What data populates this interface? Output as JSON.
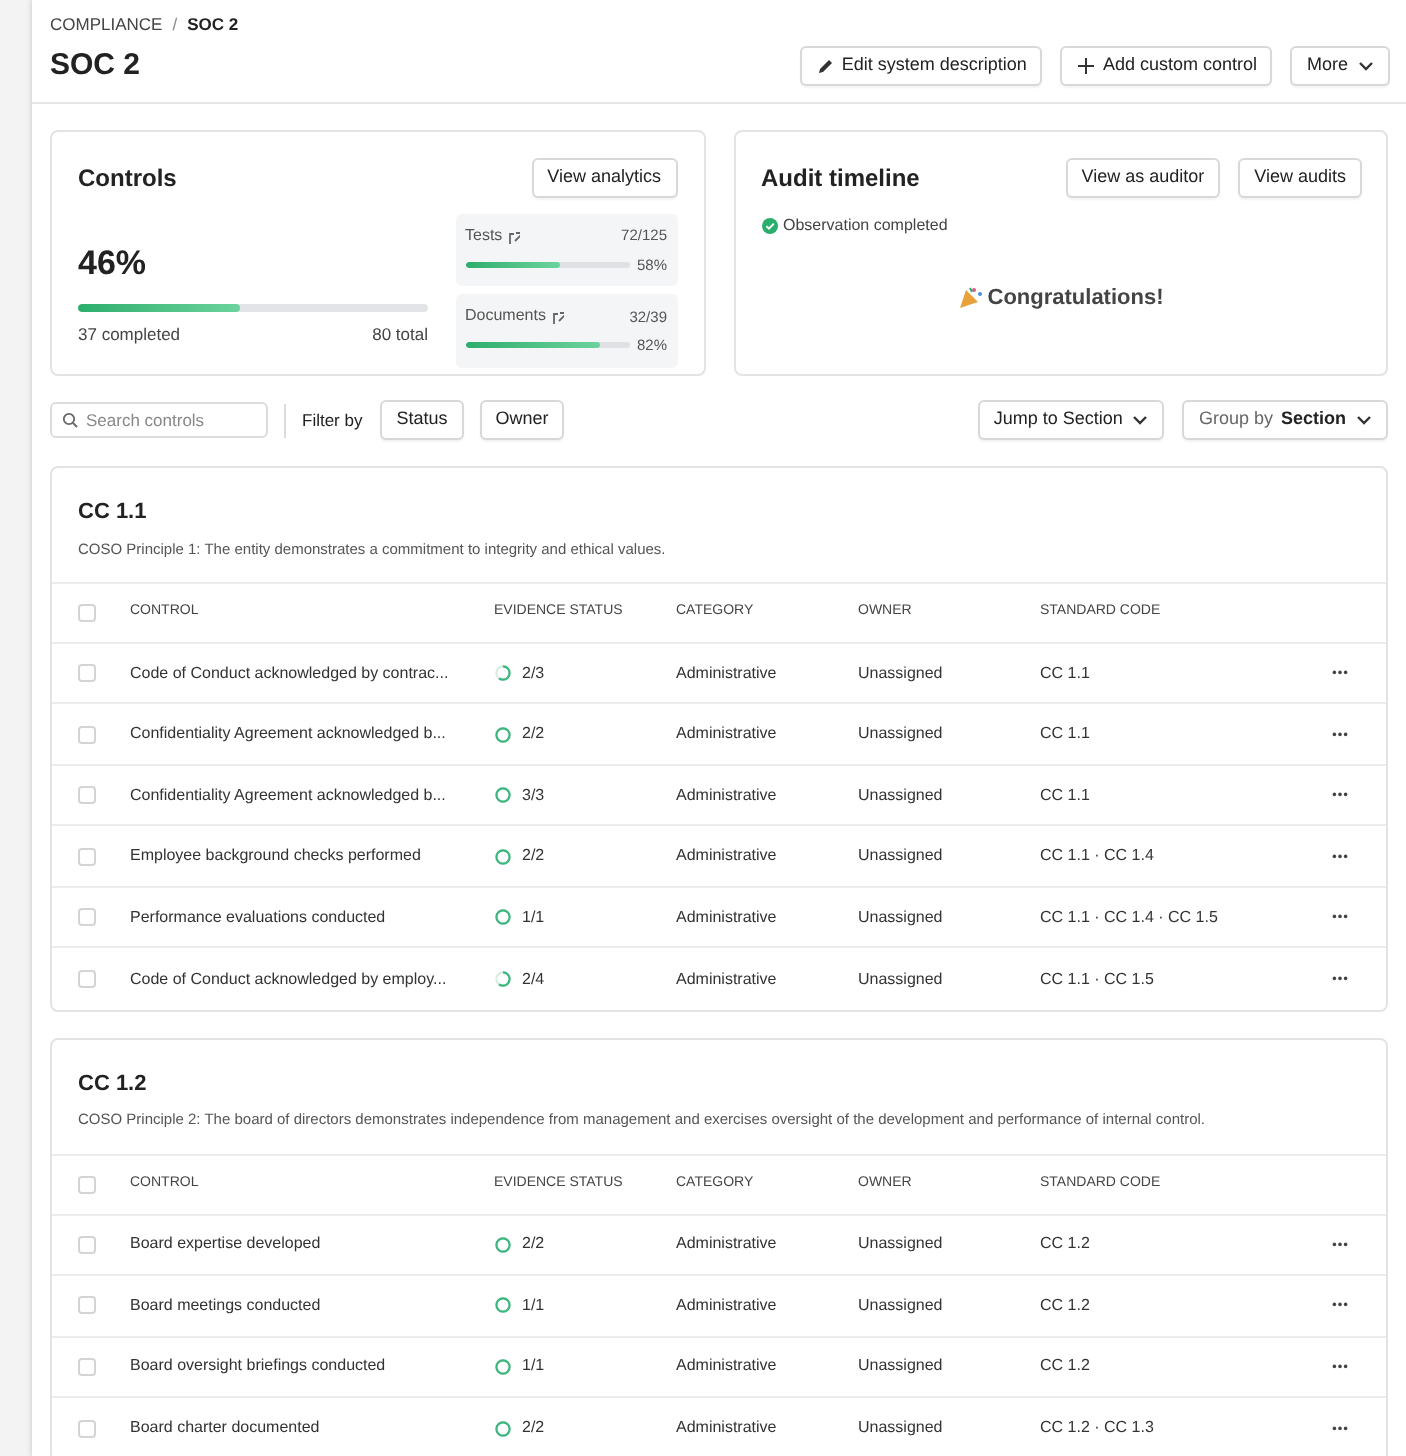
{
  "breadcrumb": [
    "COMPLIANCE",
    "/",
    "SOC 2"
  ],
  "title": "SOC 2",
  "header_buttons": [
    {
      "kind": "edit",
      "label": "Edit system description"
    },
    {
      "kind": "add",
      "label": "Add custom control"
    },
    {
      "kind": "dropdown",
      "label": "More"
    }
  ],
  "controls_card": {
    "title": "Controls",
    "button": "View analytics",
    "percent": "46%",
    "level": 0.46,
    "completed": "37 completed",
    "total": "80 total",
    "metrics": [
      {
        "label": "Tests",
        "count": "72/125",
        "percent": "58%",
        "level": 0.58
      },
      {
        "label": "Documents",
        "count": "32/39",
        "percent": "82%",
        "level": 0.82
      }
    ]
  },
  "audit_card": {
    "title": "Audit timeline",
    "buttons": [
      "View as auditor",
      "View audits"
    ],
    "status": "Observation completed",
    "message": "Congratulations!"
  },
  "toolbar": {
    "search_placeholder": "Search controls",
    "filter_label": "Filter by",
    "filters": [
      "Status",
      "Owner"
    ],
    "jump": "Jump to Section",
    "group_label": "Group by",
    "group_value": "Section"
  },
  "sections": [
    {
      "title": "CC 1.1",
      "description": "COSO Principle 1: The entity demonstrates a commitment to integrity and ethical values.",
      "select_all_checked": false,
      "columns": [
        "CONTROL",
        "EVIDENCE STATUS",
        "CATEGORY",
        "OWNER",
        "STANDARD CODE"
      ],
      "rows": [
        {
          "control": "Code of Conduct acknowledged by contrac...",
          "evidence": "2/3",
          "complete": false,
          "category": "Administrative",
          "owner": "Unassigned",
          "code": "CC 1.1",
          "checked": false
        },
        {
          "control": "Confidentiality Agreement acknowledged b...",
          "evidence": "2/2",
          "complete": true,
          "category": "Administrative",
          "owner": "Unassigned",
          "code": "CC 1.1",
          "checked": false
        },
        {
          "control": "Confidentiality Agreement acknowledged b...",
          "evidence": "3/3",
          "complete": true,
          "category": "Administrative",
          "owner": "Unassigned",
          "code": "CC 1.1",
          "checked": false
        },
        {
          "control": "Employee background checks performed",
          "evidence": "2/2",
          "complete": true,
          "category": "Administrative",
          "owner": "Unassigned",
          "code": "CC 1.1 · CC 1.4",
          "checked": false
        },
        {
          "control": "Performance evaluations conducted",
          "evidence": "1/1",
          "complete": true,
          "category": "Administrative",
          "owner": "Unassigned",
          "code": "CC 1.1 · CC 1.4 · CC 1.5",
          "checked": false
        },
        {
          "control": "Code of Conduct acknowledged by employ...",
          "evidence": "2/4",
          "complete": false,
          "category": "Administrative",
          "owner": "Unassigned",
          "code": "CC 1.1 · CC 1.5",
          "checked": false
        }
      ]
    },
    {
      "title": "CC 1.2",
      "description": "COSO Principle 2: The board of directors demonstrates independence from management and exercises oversight of the development and performance of internal control.",
      "select_all_checked": false,
      "columns": [
        "CONTROL",
        "EVIDENCE STATUS",
        "CATEGORY",
        "OWNER",
        "STANDARD CODE"
      ],
      "rows": [
        {
          "control": "Board expertise developed",
          "evidence": "2/2",
          "complete": true,
          "category": "Administrative",
          "owner": "Unassigned",
          "code": "CC 1.2",
          "checked": false
        },
        {
          "control": "Board meetings conducted",
          "evidence": "1/1",
          "complete": true,
          "category": "Administrative",
          "owner": "Unassigned",
          "code": "CC 1.2",
          "checked": false
        },
        {
          "control": "Board oversight briefings conducted",
          "evidence": "1/1",
          "complete": true,
          "category": "Administrative",
          "owner": "Unassigned",
          "code": "CC 1.2",
          "checked": false
        },
        {
          "control": "Board charter documented",
          "evidence": "2/2",
          "complete": true,
          "category": "Administrative",
          "owner": "Unassigned",
          "code": "CC 1.2 · CC 1.3",
          "checked": false
        }
      ]
    }
  ]
}
